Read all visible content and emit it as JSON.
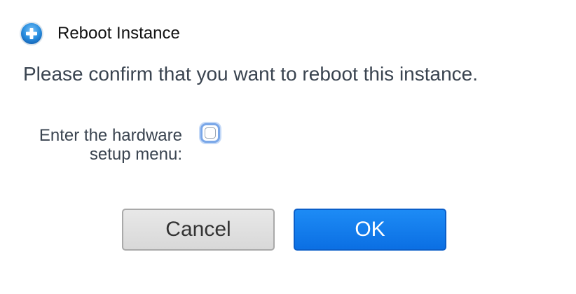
{
  "dialog": {
    "title": "Reboot Instance",
    "title_icon": "plus-circle-icon",
    "accent_color": "#1a7cf0",
    "message": "Please confirm that you want to reboot this instance.",
    "option": {
      "label_line1": "Enter the hardware",
      "label_line2": "setup menu:",
      "checked": false
    },
    "buttons": {
      "cancel_label": "Cancel",
      "ok_label": "OK"
    }
  }
}
